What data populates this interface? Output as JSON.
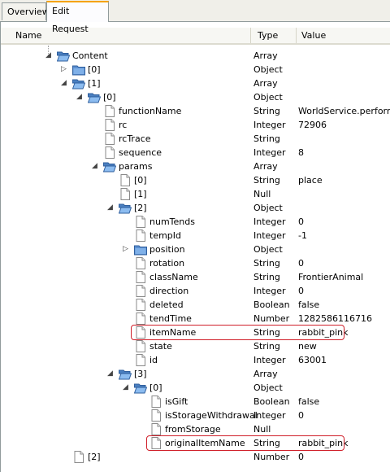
{
  "tabs": [
    {
      "label": "Overview",
      "active": false
    },
    {
      "label": "Edit Request",
      "active": true
    }
  ],
  "columns": {
    "name": "Name",
    "type": "Type",
    "value": "Value"
  },
  "rows": [
    {
      "name": "Content",
      "type": "Array",
      "value": "",
      "depth": 3,
      "icon": "folder-open",
      "expander": "expanded"
    },
    {
      "name": "[0]",
      "type": "Object",
      "value": "",
      "depth": 4,
      "icon": "folder",
      "expander": "collapsed"
    },
    {
      "name": "[1]",
      "type": "Array",
      "value": "",
      "depth": 4,
      "icon": "folder-open",
      "expander": "expanded"
    },
    {
      "name": "[0]",
      "type": "Object",
      "value": "",
      "depth": 5,
      "icon": "folder-open",
      "expander": "expanded"
    },
    {
      "name": "functionName",
      "type": "String",
      "value": "WorldService.performAc",
      "depth": 6,
      "icon": "file"
    },
    {
      "name": "rc",
      "type": "Integer",
      "value": "72906",
      "depth": 6,
      "icon": "file"
    },
    {
      "name": "rcTrace",
      "type": "String",
      "value": "",
      "depth": 6,
      "icon": "file"
    },
    {
      "name": "sequence",
      "type": "Integer",
      "value": "8",
      "depth": 6,
      "icon": "file"
    },
    {
      "name": "params",
      "type": "Array",
      "value": "",
      "depth": 6,
      "icon": "folder-open",
      "expander": "expanded"
    },
    {
      "name": "[0]",
      "type": "String",
      "value": "place",
      "depth": 7,
      "icon": "file"
    },
    {
      "name": "[1]",
      "type": "Null",
      "value": "",
      "depth": 7,
      "icon": "file"
    },
    {
      "name": "[2]",
      "type": "Object",
      "value": "",
      "depth": 7,
      "icon": "folder-open",
      "expander": "expanded"
    },
    {
      "name": "numTends",
      "type": "Integer",
      "value": "0",
      "depth": 8,
      "icon": "file"
    },
    {
      "name": "tempId",
      "type": "Integer",
      "value": "-1",
      "depth": 8,
      "icon": "file"
    },
    {
      "name": "position",
      "type": "Object",
      "value": "",
      "depth": 8,
      "icon": "folder",
      "expander": "collapsed"
    },
    {
      "name": "rotation",
      "type": "String",
      "value": "0",
      "depth": 8,
      "icon": "file"
    },
    {
      "name": "className",
      "type": "String",
      "value": "FrontierAnimal",
      "depth": 8,
      "icon": "file"
    },
    {
      "name": "direction",
      "type": "Integer",
      "value": "0",
      "depth": 8,
      "icon": "file"
    },
    {
      "name": "deleted",
      "type": "Boolean",
      "value": "false",
      "depth": 8,
      "icon": "file"
    },
    {
      "name": "tendTime",
      "type": "Number",
      "value": "1282586116716",
      "depth": 8,
      "icon": "file"
    },
    {
      "name": "itemName",
      "type": "String",
      "value": "rabbit_pink",
      "depth": 8,
      "icon": "file",
      "highlight": true
    },
    {
      "name": "state",
      "type": "String",
      "value": "new",
      "depth": 8,
      "icon": "file"
    },
    {
      "name": "id",
      "type": "Integer",
      "value": "63001",
      "depth": 8,
      "icon": "file"
    },
    {
      "name": "[3]",
      "type": "Array",
      "value": "",
      "depth": 7,
      "icon": "folder-open",
      "expander": "expanded"
    },
    {
      "name": "[0]",
      "type": "Object",
      "value": "",
      "depth": 8,
      "icon": "folder-open",
      "expander": "expanded"
    },
    {
      "name": "isGift",
      "type": "Boolean",
      "value": "false",
      "depth": 9,
      "icon": "file"
    },
    {
      "name": "isStorageWithdrawal",
      "type": "Integer",
      "value": "0",
      "depth": 9,
      "icon": "file"
    },
    {
      "name": "fromStorage",
      "type": "Null",
      "value": "",
      "depth": 9,
      "icon": "file"
    },
    {
      "name": "originalItemName",
      "type": "String",
      "value": "rabbit_pink",
      "depth": 9,
      "icon": "file",
      "highlight": true
    },
    {
      "name": "[2]",
      "type": "Number",
      "value": "0",
      "depth": 4,
      "icon": "file"
    }
  ]
}
